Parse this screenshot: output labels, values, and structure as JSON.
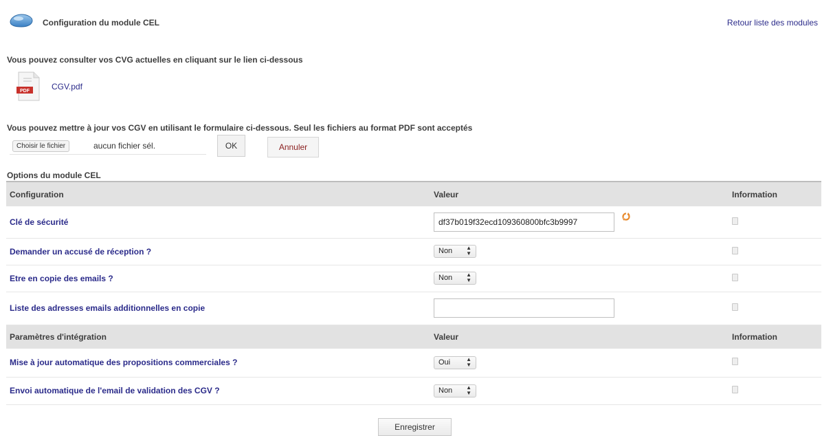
{
  "header": {
    "title": "Configuration du module CEL",
    "back_link": "Retour liste des modules",
    "module_icon": "cloud-icon"
  },
  "cgv": {
    "intro": "Vous pouvez consulter vos CVG actuelles en cliquant sur le lien ci-dessous",
    "pdf_icon": "pdf-file-icon",
    "pdf_badge": "PDF",
    "file_link": "CGV.pdf"
  },
  "upload": {
    "intro": "Vous pouvez mettre à jour vos CGV en utilisant le formulaire ci-dessous. Seul les fichiers au format PDF sont acceptés",
    "choose_label": "Choisir le fichier",
    "file_status": "aucun fichier sél.",
    "ok_label": "OK",
    "cancel_label": "Annuler"
  },
  "options": {
    "title": "Options du module CEL",
    "config_header": {
      "col1": "Configuration",
      "col2": "Valeur",
      "col3": "Information"
    },
    "config_rows": [
      {
        "label": "Clé de sécurité",
        "type": "text",
        "value": "df37b019f32ecd109360800bfc3b9997"
      },
      {
        "label": "Demander un accusé de réception ?",
        "type": "select",
        "value": "Non"
      },
      {
        "label": "Etre en copie des emails ?",
        "type": "select",
        "value": "Non"
      },
      {
        "label": "Liste des adresses emails additionnelles en copie",
        "type": "text",
        "value": ""
      }
    ],
    "integration_header": {
      "col1": "Paramètres d'intégration",
      "col2": "Valeur",
      "col3": "Information"
    },
    "integration_rows": [
      {
        "label": "Mise à jour automatique des propositions commerciales ?",
        "type": "select",
        "value": "Oui"
      },
      {
        "label": "Envoi automatique de l'email de validation des CGV ?",
        "type": "select",
        "value": "Non"
      }
    ]
  },
  "save_label": "Enregistrer",
  "colors": {
    "link": "#2b2b8a",
    "header_row": "#e2e2e2",
    "cancel_text": "#8a1f1f",
    "regen_icon": "#e8892b"
  }
}
